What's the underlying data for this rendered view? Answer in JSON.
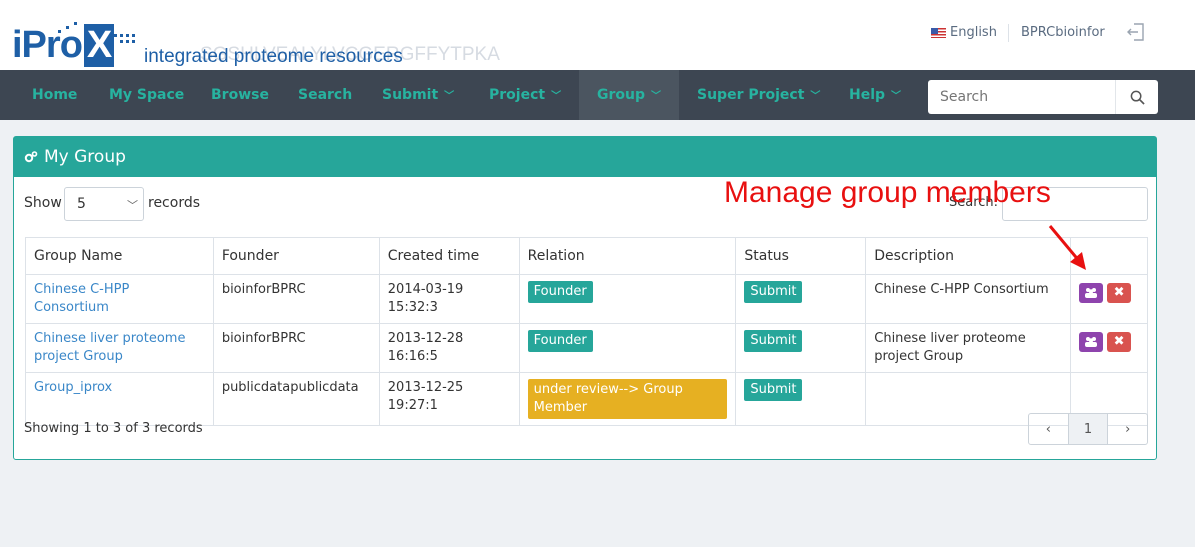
{
  "header": {
    "logo_text": "iPro",
    "logo_x": "X",
    "tagline": "integrated proteome resources",
    "watermark": "SGSHLVEALYLVCGERGFFYTPKA",
    "language": "English",
    "username": "BPRCbioinfor"
  },
  "nav": {
    "items": [
      {
        "label": "Home"
      },
      {
        "label": "My Space"
      },
      {
        "label": "Browse"
      },
      {
        "label": "Search"
      },
      {
        "label": "Submit"
      },
      {
        "label": "Project"
      },
      {
        "label": "Group"
      },
      {
        "label": "Super Project"
      },
      {
        "label": "Help"
      }
    ],
    "search_placeholder": "Search"
  },
  "panel": {
    "title": "My Group",
    "show_label": "Show",
    "show_value": "5",
    "records_label": "records",
    "filter_label": "Search:",
    "annotation": "Manage  group  members",
    "columns": [
      "Group Name",
      "Founder",
      "Created time",
      "Relation",
      "Status",
      "Description",
      ""
    ],
    "rows": [
      {
        "name": "Chinese C-HPP Consortium",
        "founder": "bioinforBPRC",
        "created": "2014-03-19 15:32:3",
        "relation": "Founder",
        "status": "Submit",
        "description": "Chinese C-HPP Consortium"
      },
      {
        "name": "Chinese liver proteome project Group",
        "founder": "bioinforBPRC",
        "created": "2013-12-28 16:16:5",
        "relation": "Founder",
        "status": "Submit",
        "description": "Chinese liver proteome project Group"
      },
      {
        "name": "Group_iprox",
        "founder": "publicdatapublicdata",
        "created": "2013-12-25 19:27:1",
        "relation": "under review--> Group Member",
        "status": "Submit",
        "description": ""
      }
    ],
    "showing": "Showing 1 to 3 of 3 records",
    "pager": {
      "prev": "‹",
      "page": "1",
      "next": "›"
    }
  },
  "colors": {
    "accent": "#26a69a",
    "navbar": "#3d4652",
    "link": "#3a87c8",
    "review": "#e6b022",
    "members_btn": "#8e44ad",
    "delete_btn": "#d9534f",
    "annotation": "#e81010"
  }
}
